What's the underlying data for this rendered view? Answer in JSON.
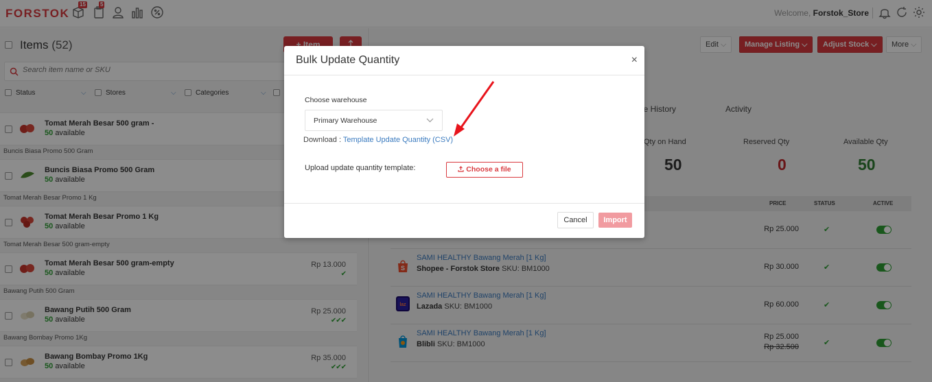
{
  "app": {
    "logo": "FORSTOK",
    "badges": {
      "box": "15",
      "clipboard": "5"
    },
    "welcome_prefix": "Welcome,",
    "welcome_user": "Forstok_Store"
  },
  "left": {
    "items_label": "Items",
    "items_count": "(52)",
    "add_item_label": "+ Item",
    "search_placeholder": "Search item name or SKU",
    "filters": [
      "Status",
      "Stores",
      "Categories"
    ],
    "rows": [
      {
        "group": "",
        "name": "Tomat Merah Besar 500 gram -",
        "qty": "50",
        "avail": "available",
        "price": "",
        "ticks": ""
      },
      {
        "group": "Buncis Biasa Promo 500 Gram",
        "name": "Buncis Biasa Promo 500 Gram",
        "qty": "50",
        "avail": "available",
        "price": "",
        "ticks": ""
      },
      {
        "group": "Tomat Merah Besar Promo 1 Kg",
        "name": "Tomat Merah Besar Promo 1 Kg",
        "qty": "50",
        "avail": "available",
        "price": "",
        "ticks": ""
      },
      {
        "group": "Tomat Merah Besar 500 gram-empty",
        "name": "Tomat Merah Besar 500 gram-empty",
        "qty": "50",
        "avail": "available",
        "price": "Rp 13.000",
        "ticks": "✔"
      },
      {
        "group": "Bawang Putih 500 Gram",
        "name": "Bawang Putih 500 Gram",
        "qty": "50",
        "avail": "available",
        "price": "Rp 25.000",
        "ticks": "✔✔✔"
      },
      {
        "group": "Bawang Bombay Promo 1Kg",
        "name": "Bawang Bombay Promo 1Kg",
        "qty": "50",
        "avail": "available",
        "price": "Rp 35.000",
        "ticks": "✔✔✔"
      }
    ]
  },
  "right": {
    "buttons": {
      "edit": "Edit",
      "manage_listing": "Manage Listing",
      "adjust_stock": "Adjust Stock",
      "more": "More"
    },
    "tabs": [
      "ice History",
      "Activity"
    ],
    "stats": [
      {
        "label": "Qty on Hand",
        "value": "50",
        "color": "#333333"
      },
      {
        "label": "Reserved Qty",
        "value": "0",
        "color": "#c0282d"
      },
      {
        "label": "Available Qty",
        "value": "50",
        "color": "#2e7d32"
      }
    ],
    "table_headers": {
      "price": "PRICE",
      "status": "STATUS",
      "active": "ACTIVE"
    },
    "listings": [
      {
        "title": "",
        "store": "",
        "sku": "",
        "price": "Rp  25.000",
        "old_price": "",
        "icon": "unknown-store-icon"
      },
      {
        "title": "SAMI HEALTHY Bawang Merah [1 Kg]",
        "store": "Shopee - Forstok Store",
        "sku": "SKU: BM1000",
        "price": "Rp  30.000",
        "old_price": "",
        "icon": "shopee-icon"
      },
      {
        "title": "SAMI HEALTHY Bawang Merah [1 Kg]",
        "store": "Lazada",
        "sku": "SKU: BM1000",
        "price": "Rp  60.000",
        "old_price": "",
        "icon": "lazada-icon"
      },
      {
        "title": "SAMI HEALTHY Bawang Merah [1 Kg]",
        "store": "Blibli",
        "sku": "SKU: BM1000",
        "price": "Rp 25.000",
        "old_price": "Rp  32.500",
        "icon": "blibli-icon"
      }
    ]
  },
  "modal": {
    "title": "Bulk Update Quantity",
    "close": "×",
    "warehouse_label": "Choose warehouse",
    "warehouse_value": "Primary Warehouse",
    "download_prefix": "Download :",
    "download_link": "Template Update Quantity (CSV)",
    "upload_label": "Upload update quantity template:",
    "choose_file": "Choose a file",
    "cancel": "Cancel",
    "import": "Import"
  }
}
